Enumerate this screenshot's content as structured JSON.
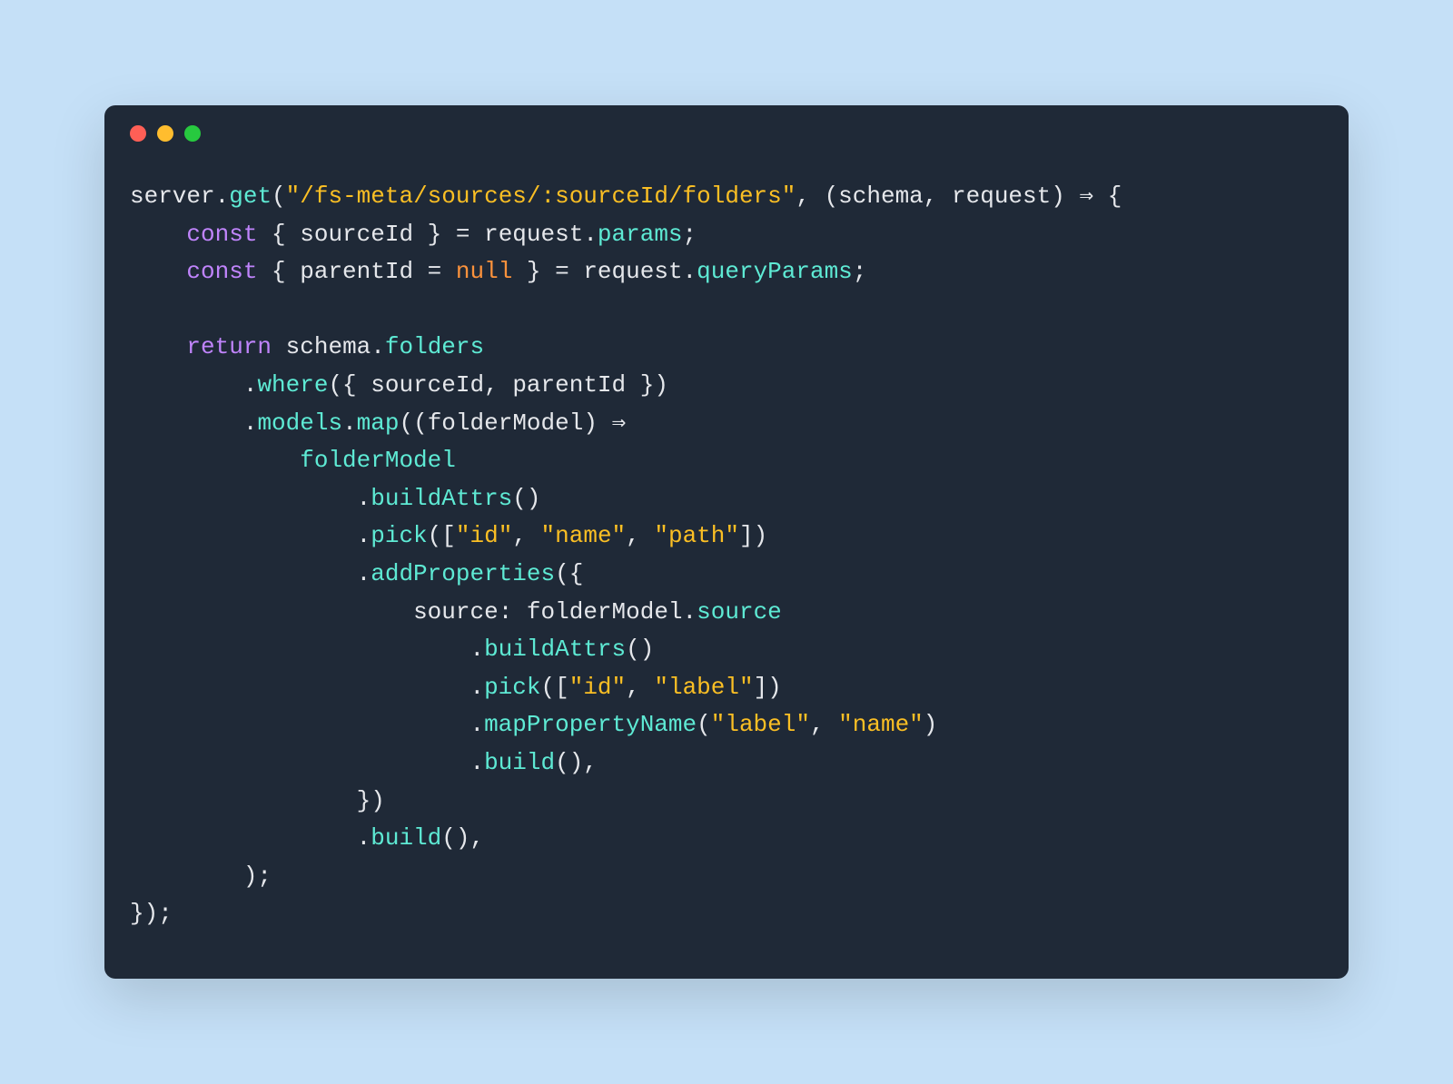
{
  "window": {
    "traffic_lights": [
      "red",
      "yellow",
      "green"
    ]
  },
  "code": {
    "tokens": [
      [
        {
          "t": "server",
          "c": "tok-identifier"
        },
        {
          "t": ".",
          "c": "tok-punct"
        },
        {
          "t": "get",
          "c": "tok-method"
        },
        {
          "t": "(",
          "c": "tok-paren"
        },
        {
          "t": "\"/fs-meta/sources/:sourceId/folders\"",
          "c": "tok-string"
        },
        {
          "t": ", (",
          "c": "tok-punct"
        },
        {
          "t": "schema",
          "c": "tok-identifier"
        },
        {
          "t": ", ",
          "c": "tok-punct"
        },
        {
          "t": "request",
          "c": "tok-identifier"
        },
        {
          "t": ") ",
          "c": "tok-punct"
        },
        {
          "t": "⇒",
          "c": "tok-arrow"
        },
        {
          "t": " {",
          "c": "tok-brace"
        }
      ],
      [
        {
          "t": "    ",
          "c": "tok-punct"
        },
        {
          "t": "const",
          "c": "tok-keyword"
        },
        {
          "t": " { ",
          "c": "tok-punct"
        },
        {
          "t": "sourceId",
          "c": "tok-identifier"
        },
        {
          "t": " } = ",
          "c": "tok-punct"
        },
        {
          "t": "request",
          "c": "tok-identifier"
        },
        {
          "t": ".",
          "c": "tok-punct"
        },
        {
          "t": "params",
          "c": "tok-method"
        },
        {
          "t": ";",
          "c": "tok-punct"
        }
      ],
      [
        {
          "t": "    ",
          "c": "tok-punct"
        },
        {
          "t": "const",
          "c": "tok-keyword"
        },
        {
          "t": " { ",
          "c": "tok-punct"
        },
        {
          "t": "parentId",
          "c": "tok-identifier"
        },
        {
          "t": " = ",
          "c": "tok-punct"
        },
        {
          "t": "null",
          "c": "tok-null"
        },
        {
          "t": " } = ",
          "c": "tok-punct"
        },
        {
          "t": "request",
          "c": "tok-identifier"
        },
        {
          "t": ".",
          "c": "tok-punct"
        },
        {
          "t": "queryParams",
          "c": "tok-method"
        },
        {
          "t": ";",
          "c": "tok-punct"
        }
      ],
      [
        {
          "t": "",
          "c": "tok-punct"
        }
      ],
      [
        {
          "t": "    ",
          "c": "tok-punct"
        },
        {
          "t": "return",
          "c": "tok-keyword"
        },
        {
          "t": " ",
          "c": "tok-punct"
        },
        {
          "t": "schema",
          "c": "tok-identifier"
        },
        {
          "t": ".",
          "c": "tok-punct"
        },
        {
          "t": "folders",
          "c": "tok-method"
        }
      ],
      [
        {
          "t": "        .",
          "c": "tok-punct"
        },
        {
          "t": "where",
          "c": "tok-method"
        },
        {
          "t": "({ ",
          "c": "tok-punct"
        },
        {
          "t": "sourceId",
          "c": "tok-identifier"
        },
        {
          "t": ", ",
          "c": "tok-punct"
        },
        {
          "t": "parentId",
          "c": "tok-identifier"
        },
        {
          "t": " })",
          "c": "tok-punct"
        }
      ],
      [
        {
          "t": "        .",
          "c": "tok-punct"
        },
        {
          "t": "models",
          "c": "tok-method"
        },
        {
          "t": ".",
          "c": "tok-punct"
        },
        {
          "t": "map",
          "c": "tok-method"
        },
        {
          "t": "((",
          "c": "tok-punct"
        },
        {
          "t": "folderModel",
          "c": "tok-identifier"
        },
        {
          "t": ") ",
          "c": "tok-punct"
        },
        {
          "t": "⇒",
          "c": "tok-arrow"
        }
      ],
      [
        {
          "t": "            ",
          "c": "tok-punct"
        },
        {
          "t": "folderModel",
          "c": "tok-method"
        }
      ],
      [
        {
          "t": "                .",
          "c": "tok-punct"
        },
        {
          "t": "buildAttrs",
          "c": "tok-method"
        },
        {
          "t": "()",
          "c": "tok-punct"
        }
      ],
      [
        {
          "t": "                .",
          "c": "tok-punct"
        },
        {
          "t": "pick",
          "c": "tok-method"
        },
        {
          "t": "([",
          "c": "tok-punct"
        },
        {
          "t": "\"id\"",
          "c": "tok-string"
        },
        {
          "t": ", ",
          "c": "tok-punct"
        },
        {
          "t": "\"name\"",
          "c": "tok-string"
        },
        {
          "t": ", ",
          "c": "tok-punct"
        },
        {
          "t": "\"path\"",
          "c": "tok-string"
        },
        {
          "t": "])",
          "c": "tok-punct"
        }
      ],
      [
        {
          "t": "                .",
          "c": "tok-punct"
        },
        {
          "t": "addProperties",
          "c": "tok-method"
        },
        {
          "t": "({",
          "c": "tok-punct"
        }
      ],
      [
        {
          "t": "                    ",
          "c": "tok-punct"
        },
        {
          "t": "source",
          "c": "tok-identifier"
        },
        {
          "t": ": ",
          "c": "tok-punct"
        },
        {
          "t": "folderModel",
          "c": "tok-identifier"
        },
        {
          "t": ".",
          "c": "tok-punct"
        },
        {
          "t": "source",
          "c": "tok-method"
        }
      ],
      [
        {
          "t": "                        .",
          "c": "tok-punct"
        },
        {
          "t": "buildAttrs",
          "c": "tok-method"
        },
        {
          "t": "()",
          "c": "tok-punct"
        }
      ],
      [
        {
          "t": "                        .",
          "c": "tok-punct"
        },
        {
          "t": "pick",
          "c": "tok-method"
        },
        {
          "t": "([",
          "c": "tok-punct"
        },
        {
          "t": "\"id\"",
          "c": "tok-string"
        },
        {
          "t": ", ",
          "c": "tok-punct"
        },
        {
          "t": "\"label\"",
          "c": "tok-string"
        },
        {
          "t": "])",
          "c": "tok-punct"
        }
      ],
      [
        {
          "t": "                        .",
          "c": "tok-punct"
        },
        {
          "t": "mapPropertyName",
          "c": "tok-method"
        },
        {
          "t": "(",
          "c": "tok-punct"
        },
        {
          "t": "\"label\"",
          "c": "tok-string"
        },
        {
          "t": ", ",
          "c": "tok-punct"
        },
        {
          "t": "\"name\"",
          "c": "tok-string"
        },
        {
          "t": ")",
          "c": "tok-punct"
        }
      ],
      [
        {
          "t": "                        .",
          "c": "tok-punct"
        },
        {
          "t": "build",
          "c": "tok-method"
        },
        {
          "t": "(),",
          "c": "tok-punct"
        }
      ],
      [
        {
          "t": "                })",
          "c": "tok-punct"
        }
      ],
      [
        {
          "t": "                .",
          "c": "tok-punct"
        },
        {
          "t": "build",
          "c": "tok-method"
        },
        {
          "t": "(),",
          "c": "tok-punct"
        }
      ],
      [
        {
          "t": "        );",
          "c": "tok-punct"
        }
      ],
      [
        {
          "t": "});",
          "c": "tok-punct"
        }
      ]
    ]
  },
  "colors": {
    "background": "#c5e0f7",
    "terminal_bg": "#1f2937",
    "red": "#ff5f56",
    "yellow": "#ffbd2e",
    "green": "#27c93f",
    "identifier": "#e5e7eb",
    "method": "#5eead4",
    "keyword": "#c084fc",
    "string": "#fbbf24",
    "null": "#fb923c"
  }
}
